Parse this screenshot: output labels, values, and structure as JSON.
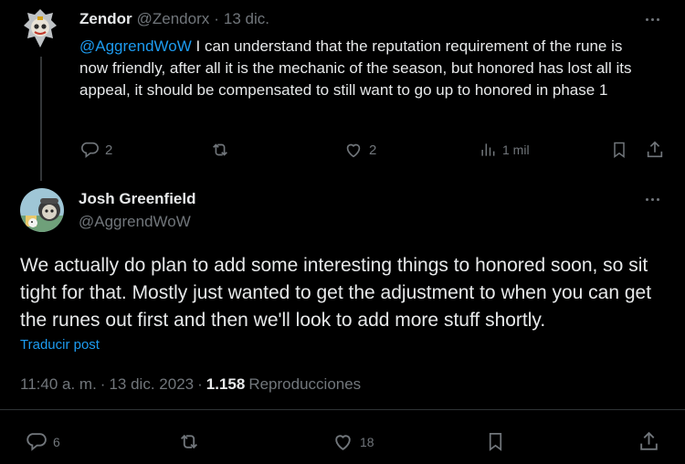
{
  "reply_tweet": {
    "author_name": "Zendor",
    "author_handle": "@Zendorx",
    "separator": "·",
    "date": "13 dic.",
    "mention": "@AggrendWoW",
    "text": " I can understand that the reputation requirement of the rune is now friendly, after all it is the mechanic of the season, but honored has lost all its appeal, it should be compensated to still want to go up to honored in phase 1",
    "actions": {
      "replies": "2",
      "reposts": "",
      "likes": "2",
      "views": "1 mil"
    }
  },
  "main_tweet": {
    "author_name": "Josh Greenfield",
    "author_handle": "@AggrendWoW",
    "text": "We actually do plan to add some interesting things to honored soon, so sit tight for that. Mostly just wanted to get the adjustment to when you can get the runes out first and then we'll look to add more stuff shortly.",
    "translate_label": "Traducir post",
    "meta": {
      "time": "11:40 a. m.",
      "dot1": "·",
      "date": "13 dic. 2023",
      "dot2": "·",
      "views_count": "1.158",
      "views_label": "Reproducciones"
    },
    "actions": {
      "replies": "6",
      "reposts": "",
      "likes": "18"
    }
  },
  "colors": {
    "background": "#000000",
    "text": "#e7e9ea",
    "muted": "#71767b",
    "link": "#1d9bf0",
    "divider": "#2f3336"
  }
}
